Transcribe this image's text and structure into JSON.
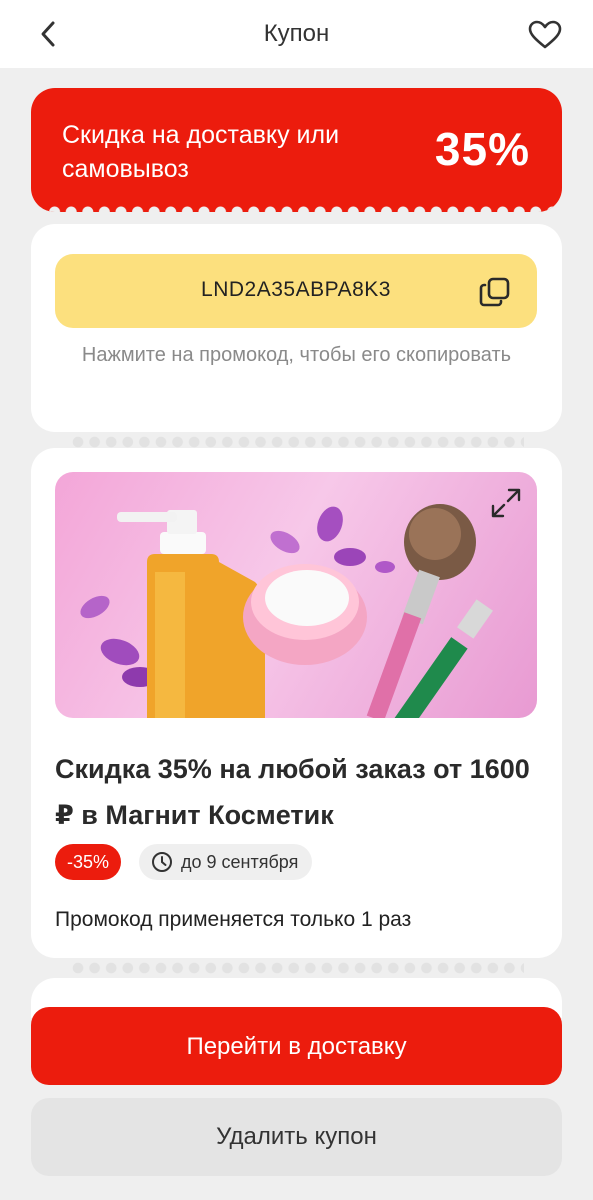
{
  "header": {
    "title": "Купон",
    "back_icon": "chevron-left-icon",
    "favorite_icon": "heart-icon"
  },
  "coupon": {
    "description": "Скидка на доставку или самовывоз",
    "discount": "35%",
    "accent_color": "#ec1c0d"
  },
  "promo": {
    "code": "LND2A35ABPA8K3",
    "copy_icon": "copy-icon",
    "hint": "Нажмите на промокод, чтобы его скопировать",
    "bg_color": "#fce07e"
  },
  "offer": {
    "image_icon": "cosmetics-image",
    "expand_icon": "expand-icon",
    "title": "Скидка 35% на любой заказ от 1600 ₽ в Магнит Косметик",
    "badge_discount": "-35%",
    "clock_icon": "clock-icon",
    "badge_date": "до 9 сентября",
    "note": "Промокод применяется только 1 раз"
  },
  "actions": {
    "primary_label": "Перейти в доставку",
    "secondary_label": "Удалить купон"
  }
}
